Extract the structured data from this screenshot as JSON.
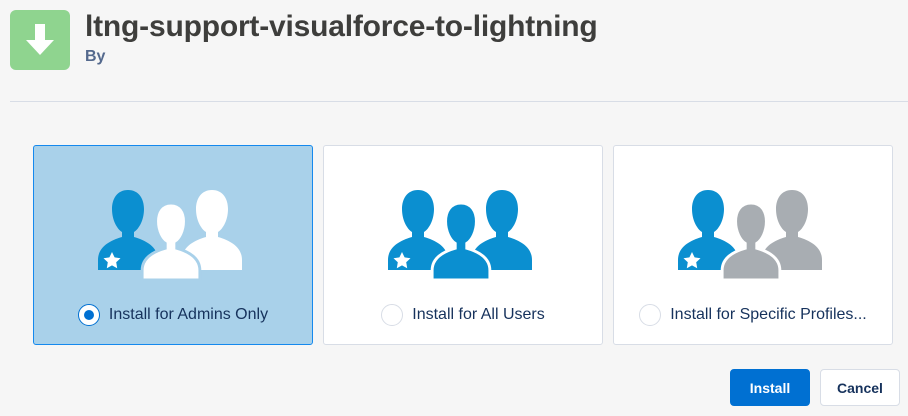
{
  "package": {
    "icon": "download-arrow-icon",
    "title": "ltng-support-visualforce-to-lightning",
    "by": "By"
  },
  "options": [
    {
      "label": "Install for Admins Only",
      "selected": true,
      "icon": "admins-group-icon"
    },
    {
      "label": "Install for All Users",
      "selected": false,
      "icon": "all-users-group-icon"
    },
    {
      "label": "Install for Specific Profiles...",
      "selected": false,
      "icon": "specific-profiles-group-icon"
    }
  ],
  "buttons": {
    "install": "Install",
    "cancel": "Cancel"
  },
  "colors": {
    "brand_blue": "#0070d2",
    "person_blue": "#0b8fd0",
    "person_gray": "#a8adb2",
    "selected_bg": "#a9d1ea",
    "icon_green": "#8fd48f"
  }
}
